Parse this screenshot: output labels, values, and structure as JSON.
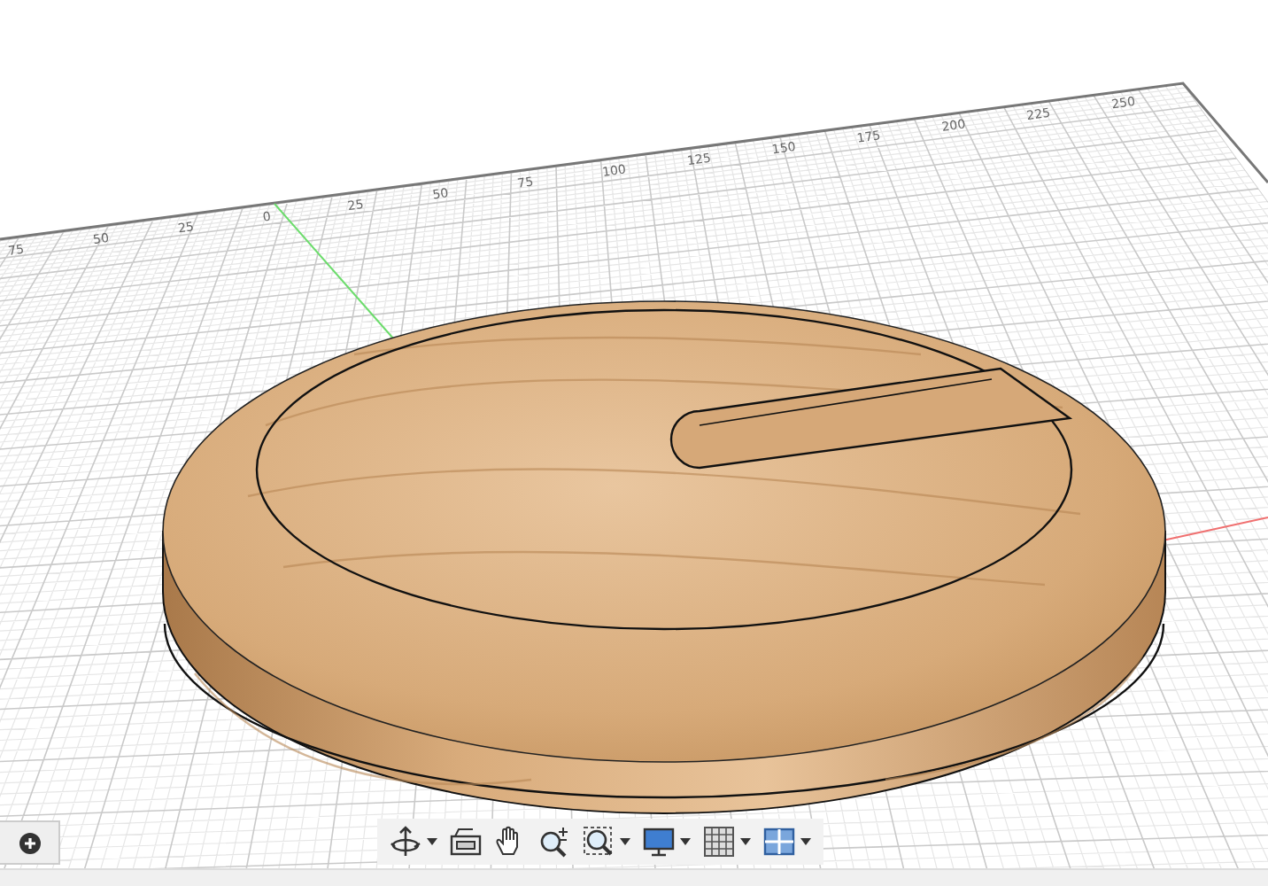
{
  "ruler_labels": [
    "75",
    "50",
    "25",
    "0",
    "25",
    "50",
    "75",
    "100",
    "125",
    "150",
    "175",
    "200",
    "225",
    "250"
  ],
  "toolbar": [
    {
      "kind": "orbit",
      "has_menu": true
    },
    {
      "kind": "look",
      "has_menu": false
    },
    {
      "kind": "pan",
      "has_menu": false
    },
    {
      "kind": "zoom",
      "has_menu": false
    },
    {
      "kind": "fit",
      "has_menu": true
    },
    {
      "kind": "display",
      "has_menu": true
    },
    {
      "kind": "grid",
      "has_menu": true
    },
    {
      "kind": "viewports",
      "has_menu": true
    }
  ]
}
